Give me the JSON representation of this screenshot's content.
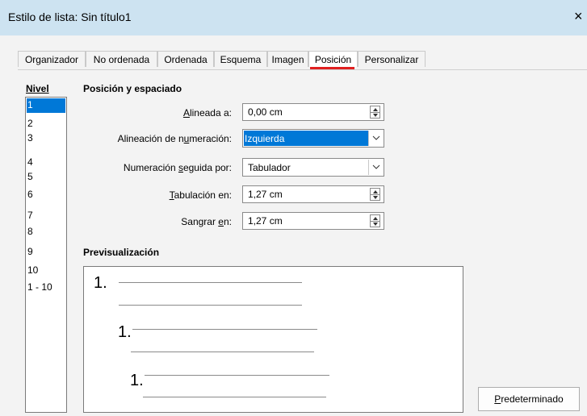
{
  "window": {
    "title": "Estilo de lista: Sin título1",
    "close_glyph": "×"
  },
  "tabs": [
    {
      "label": "Organizador",
      "active": false
    },
    {
      "label": "No ordenada",
      "active": false
    },
    {
      "label": "Ordenada",
      "active": false
    },
    {
      "label": "Esquema",
      "active": false
    },
    {
      "label": "Imagen",
      "active": false
    },
    {
      "label": "Posición",
      "active": true
    },
    {
      "label": "Personalizar",
      "active": false
    }
  ],
  "level": {
    "header": "Nivel",
    "items": [
      "1",
      "2",
      "3",
      "4",
      "5",
      "6",
      "7",
      "8",
      "9",
      "10",
      "1 - 10"
    ],
    "selected_index": 0
  },
  "position": {
    "section_title": "Posición y espaciado",
    "aligned_at": {
      "label_pre": "",
      "label_u": "A",
      "label_post": "lineada a:",
      "value": "0,00 cm"
    },
    "numbering_alignment": {
      "label_pre": "Alineación de n",
      "label_u": "u",
      "label_post": "meración:",
      "value": "Izquierda"
    },
    "numbering_followed_by": {
      "label_pre": "Numeración ",
      "label_u": "s",
      "label_post": "eguida por:",
      "value": "Tabulador"
    },
    "tab_stop_at": {
      "label_pre": "",
      "label_u": "T",
      "label_post": "abulación en:",
      "value": "1,27 cm"
    },
    "indent_at": {
      "label_pre": "Sangrar ",
      "label_u": "e",
      "label_post": "n:",
      "value": "1,27 cm"
    }
  },
  "preview": {
    "title": "Previsualización",
    "numbers": [
      "1.",
      "1.",
      "1."
    ]
  },
  "buttons": {
    "default_u": "P",
    "default_rest": "redeterminado"
  },
  "colors": {
    "accent": "#0078d7",
    "active_tab_underline": "#e02020",
    "titlebar": "#cde3f1"
  },
  "icons": {
    "close": "close-icon",
    "spin": "spin-up-down-icon",
    "dropdown": "chevron-down-icon"
  }
}
